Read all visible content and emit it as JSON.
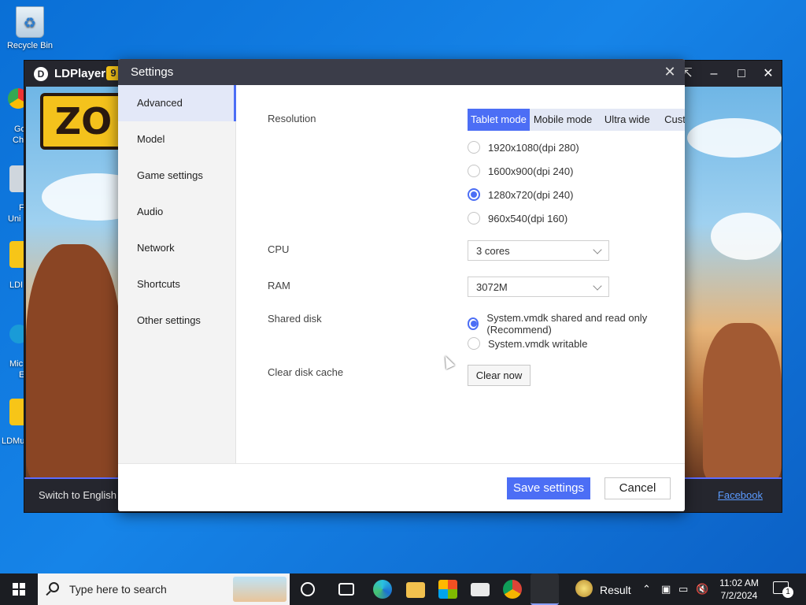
{
  "desktop": {
    "recycle_bin_label": "Recycle Bin",
    "partial_labels": [
      "Go",
      "Ch",
      "F",
      "Uni",
      "LDI",
      "Mic",
      "E",
      "LDMu"
    ]
  },
  "ldplayer": {
    "title": "LDPlayer",
    "version_badge": "9",
    "game_logo_text": "ZO",
    "switch_language": "Switch to English",
    "facebook": "Facebook",
    "icons": {
      "logo": "ldplayer-logo-icon",
      "expand": "expand-icon",
      "minimize": "minimize-icon",
      "maximize": "maximize-icon",
      "close": "close-icon"
    }
  },
  "settings": {
    "title": "Settings",
    "nav": [
      {
        "label": "Advanced",
        "active": true
      },
      {
        "label": "Model"
      },
      {
        "label": "Game settings"
      },
      {
        "label": "Audio"
      },
      {
        "label": "Network"
      },
      {
        "label": "Shortcuts"
      },
      {
        "label": "Other settings"
      }
    ],
    "resolution": {
      "label": "Resolution",
      "tabs": [
        "Tablet mode",
        "Mobile mode",
        "Ultra wide",
        "Customize"
      ],
      "active_tab": "Tablet mode",
      "options": [
        "1920x1080(dpi 280)",
        "1600x900(dpi 240)",
        "1280x720(dpi 240)",
        "960x540(dpi 160)"
      ],
      "selected": "1280x720(dpi 240)"
    },
    "cpu": {
      "label": "CPU",
      "value": "3 cores"
    },
    "ram": {
      "label": "RAM",
      "value": "3072M"
    },
    "shared_disk": {
      "label": "Shared disk",
      "options": [
        "System.vmdk shared and read only (Recommend)",
        "System.vmdk writable"
      ],
      "selected": "System.vmdk shared and read only (Recommend)"
    },
    "clear_cache": {
      "label": "Clear disk cache",
      "button": "Clear now"
    },
    "footer": {
      "save": "Save settings",
      "cancel": "Cancel"
    }
  },
  "taskbar": {
    "search_placeholder": "Type here to search",
    "result_label": "Result",
    "time": "11:02 AM",
    "date": "7/2/2024",
    "notification_count": "1",
    "accent": "#4c6ef5"
  }
}
